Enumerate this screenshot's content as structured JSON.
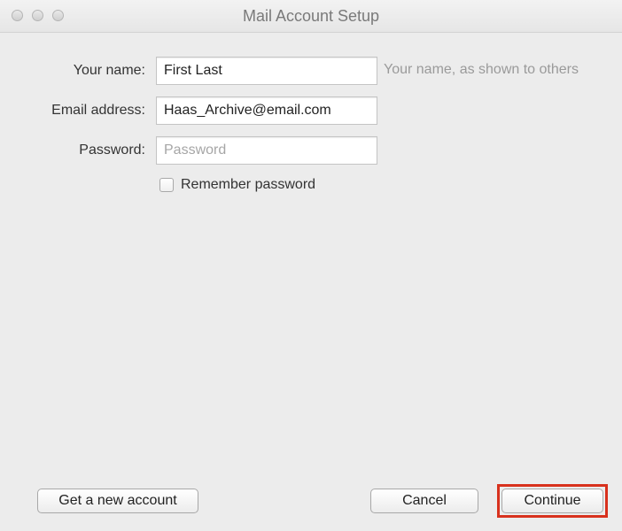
{
  "window": {
    "title": "Mail Account Setup"
  },
  "form": {
    "name": {
      "label": "Your name:",
      "value": "First Last",
      "hint": "Your name, as shown to others"
    },
    "email": {
      "label": "Email address:",
      "value": "Haas_Archive@email.com"
    },
    "password": {
      "label": "Password:",
      "placeholder": "Password",
      "value": ""
    },
    "remember": {
      "label": "Remember password",
      "checked": false
    }
  },
  "buttons": {
    "new_account": "Get a new account",
    "cancel": "Cancel",
    "continue": "Continue"
  },
  "colors": {
    "highlight": "#d8311d"
  },
  "icons": [
    "close-icon",
    "minimize-icon",
    "zoom-icon"
  ]
}
